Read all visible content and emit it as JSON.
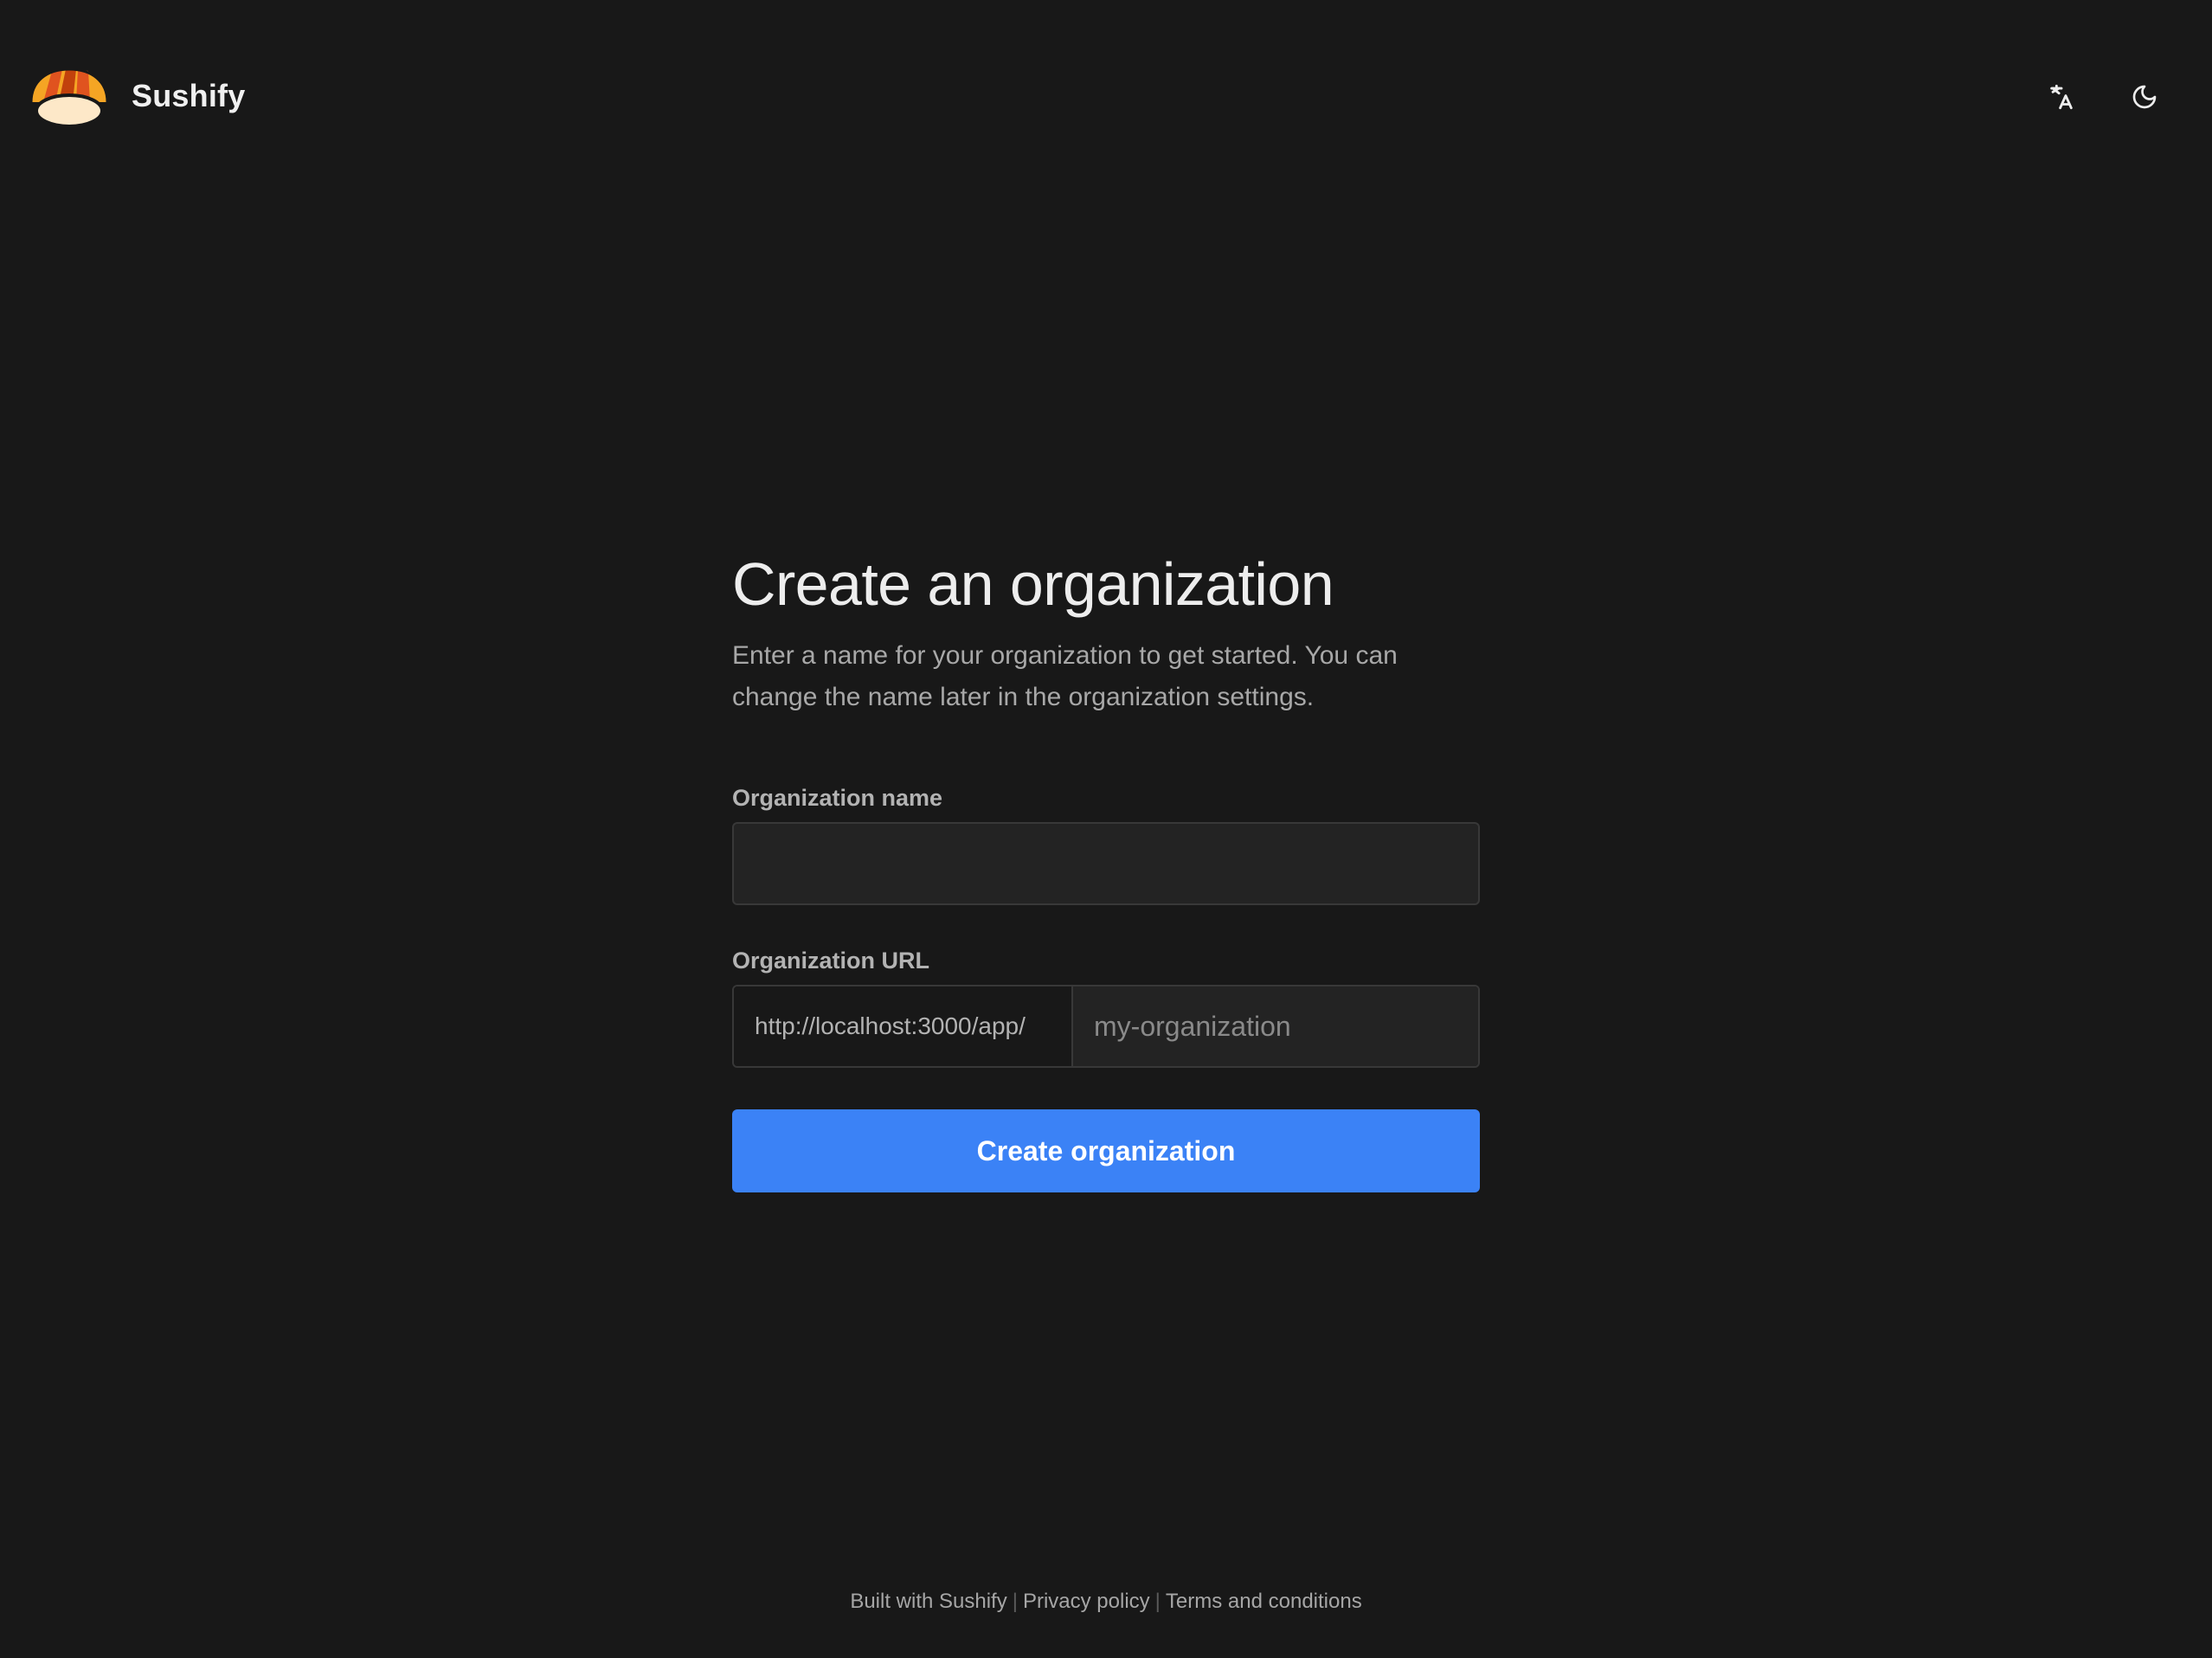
{
  "header": {
    "app_name": "Sushify",
    "logo_icon": "sushi-logo-icon",
    "actions": [
      {
        "icon": "translate-icon",
        "label": "Change language"
      },
      {
        "icon": "moon-icon",
        "label": "Toggle color mode"
      }
    ]
  },
  "main": {
    "title": "Create an organization",
    "subtitle": "Enter a name for your organization to get started. You can change the name later in the organization settings.",
    "name_field": {
      "label": "Organization name",
      "value": "",
      "placeholder": ""
    },
    "url_field": {
      "label": "Organization URL",
      "prefix": "http://localhost:3000/app/",
      "value": "",
      "placeholder": "my-organization"
    },
    "submit_label": "Create organization"
  },
  "footer": {
    "built_with": "Built with Sushify",
    "separator": "|",
    "privacy": "Privacy policy",
    "terms": "Terms and conditions"
  },
  "colors": {
    "background": "#181818",
    "input_background": "#232323",
    "border": "#383838",
    "accent": "#3b82f6",
    "logo_orange": "#f5a524",
    "logo_red": "#e0531f",
    "logo_rice": "#fde8c8"
  }
}
